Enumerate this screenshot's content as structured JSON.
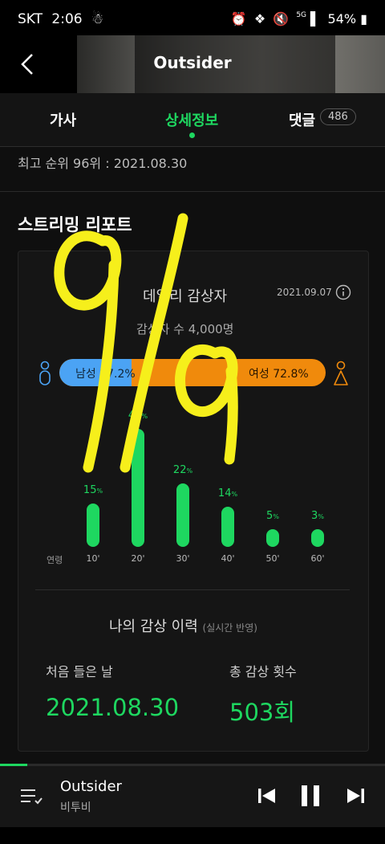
{
  "status_bar": {
    "carrier": "SKT",
    "time": "2:06",
    "battery": "54%",
    "network": "5G"
  },
  "header": {
    "title": "Outsider"
  },
  "tabs": [
    {
      "label": "가사"
    },
    {
      "label": "상세정보"
    },
    {
      "label": "댓글",
      "badge": "486"
    }
  ],
  "detail": {
    "rank_line": "최고 순위 96위 : 2021.08.30"
  },
  "report": {
    "section_title": "스트리밍 리포트",
    "card_title": "데일리 감상자",
    "date": "2021.09.07",
    "listener_count": "감상자 수 4,000명",
    "male_label": "남성 27.2%",
    "female_label": "여성 72.8%",
    "male_pct": 27.2,
    "female_pct": 72.8,
    "age_header": "연령"
  },
  "chart_data": {
    "type": "bar",
    "categories": [
      "10'",
      "20'",
      "30'",
      "40'",
      "50'",
      "60'"
    ],
    "values": [
      15,
      41,
      22,
      14,
      5,
      3
    ],
    "unit": "%",
    "xlabel": "연령",
    "ylabel": "",
    "ylim": [
      0,
      41
    ]
  },
  "history": {
    "title": "나의 감상 이력",
    "subtitle": "(실시간 반영)",
    "first_listen_label": "처음 들은 날",
    "first_listen_value": "2021.08.30",
    "total_plays_label": "총 감상 횟수",
    "total_plays_value": "503회"
  },
  "player": {
    "title": "Outsider",
    "artist": "비투비",
    "progress": 0.07
  },
  "overlay": {
    "handwriting": "9/9",
    "color": "#f6ef1b"
  },
  "colors": {
    "accent": "#1ed760",
    "male": "#4ba3f4",
    "female": "#f08a0c"
  }
}
